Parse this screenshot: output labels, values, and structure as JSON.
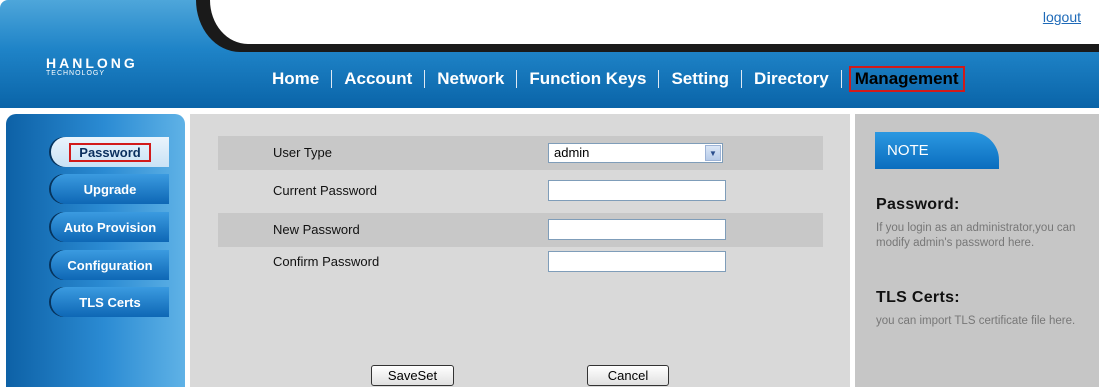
{
  "header": {
    "logo_main": "HANLONG",
    "logo_sub": "TECHNOLOGY",
    "logout": "logout"
  },
  "nav": {
    "items": [
      "Home",
      "Account",
      "Network",
      "Function Keys",
      "Setting",
      "Directory",
      "Management"
    ],
    "active": "Management"
  },
  "sidebar": {
    "items": [
      "Password",
      "Upgrade",
      "Auto Provision",
      "Configuration",
      "TLS Certs"
    ],
    "active": "Password"
  },
  "form": {
    "user_type_label": "User Type",
    "user_type_value": "admin",
    "current_password_label": "Current Password",
    "current_password_value": "",
    "new_password_label": "New Password",
    "new_password_value": "",
    "confirm_password_label": "Confirm Password",
    "confirm_password_value": "",
    "save_label": "SaveSet",
    "cancel_label": "Cancel"
  },
  "note": {
    "tab": "NOTE",
    "sections": [
      {
        "title": "Password:",
        "text": "If you login as an administrator,you can modify admin's password here."
      },
      {
        "title": "TLS Certs:",
        "text": "you can import TLS certificate file here."
      }
    ]
  },
  "colors": {
    "accent_blue": "#1f84c8",
    "highlight_red": "#d21a1a"
  }
}
